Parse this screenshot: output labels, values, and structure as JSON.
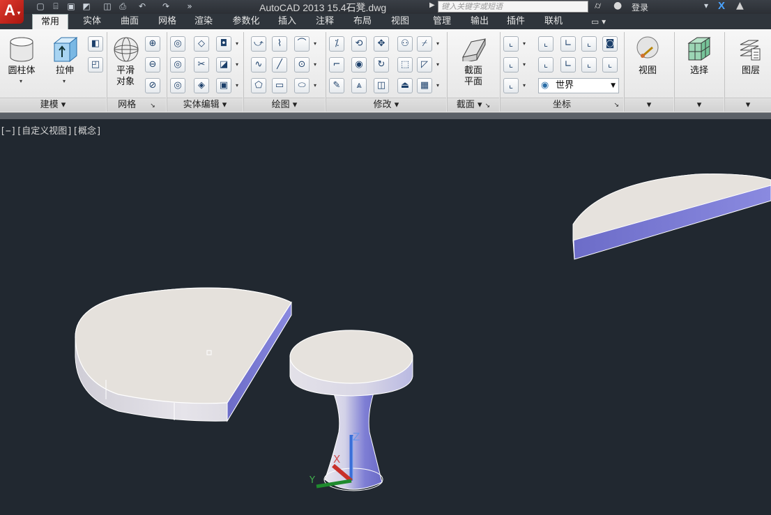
{
  "titlebar": {
    "title": "AutoCAD 2013   15.4石凳.dwg",
    "search_placeholder": "键入关键字或短语",
    "login_label": "登录",
    "logo_letter": "A"
  },
  "tabs": [
    {
      "label": "常用",
      "active": true
    },
    {
      "label": "实体"
    },
    {
      "label": "曲面"
    },
    {
      "label": "网格"
    },
    {
      "label": "渲染"
    },
    {
      "label": "参数化"
    },
    {
      "label": "插入"
    },
    {
      "label": "注释"
    },
    {
      "label": "布局"
    },
    {
      "label": "视图"
    },
    {
      "label": "管理"
    },
    {
      "label": "输出"
    },
    {
      "label": "插件"
    },
    {
      "label": "联机"
    }
  ],
  "ribbon": {
    "modeling": {
      "cylinder_label": "圆柱体",
      "extrude_label": "拉伸",
      "panel_title": "建模 ▾"
    },
    "mesh": {
      "smooth_label_1": "平滑",
      "smooth_label_2": "对象",
      "panel_title": "网格"
    },
    "solid_edit": {
      "panel_title": "实体编辑 ▾"
    },
    "draw": {
      "panel_title": "绘图 ▾"
    },
    "modify": {
      "panel_title": "修改 ▾"
    },
    "section": {
      "label_1": "截面",
      "label_2": "平面",
      "panel_title": "截面 ▾"
    },
    "coordinates": {
      "world_label": "世界",
      "panel_title": "坐标"
    },
    "view_label": "视图",
    "select_label": "选择",
    "layers_label": "图层"
  },
  "viewport": {
    "view_label": "[−][自定义视图][概念]"
  },
  "colors": {
    "background": "#212830",
    "top_face": "#e5e1dc",
    "side_face": "#7474cf",
    "rim_face": "#d8d5de"
  }
}
